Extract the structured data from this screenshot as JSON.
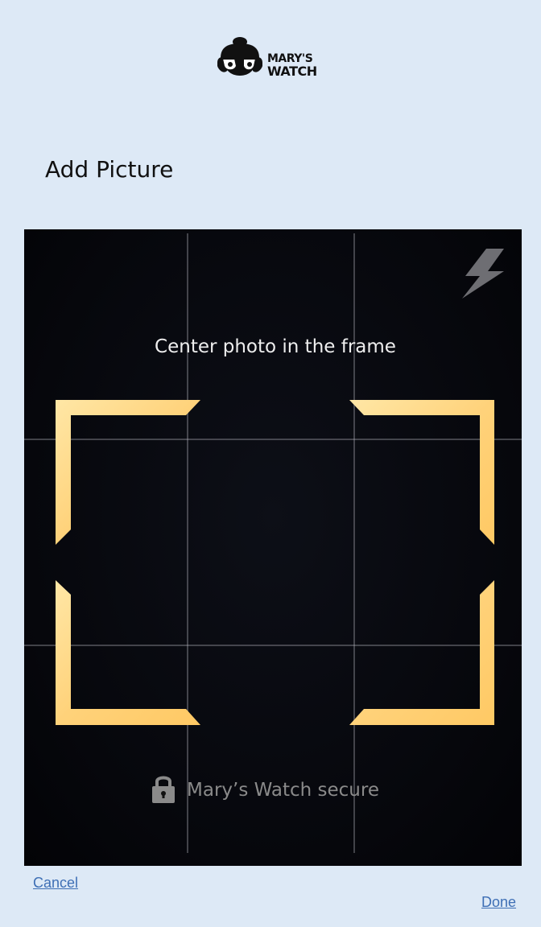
{
  "brand": {
    "line1": "MARY'S",
    "line2": "WATCH",
    "icon": "woman-with-glasses-logo"
  },
  "page": {
    "title": "Add Picture"
  },
  "camera": {
    "hint": "Center photo in the frame",
    "flash_icon": "lightning-bolt-icon",
    "frame_color": "#ffd27a",
    "secure_label": "Mary’s Watch secure",
    "lock_icon": "lock-icon"
  },
  "actions": {
    "cancel_label": "Cancel",
    "done_label": "Done"
  }
}
